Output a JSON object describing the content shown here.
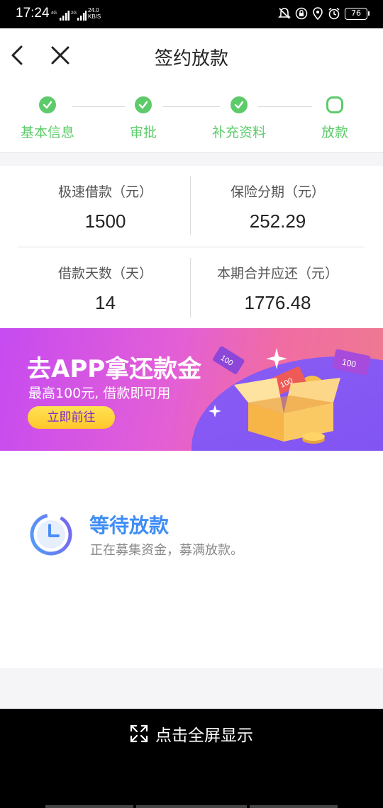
{
  "status_bar": {
    "time": "17:24",
    "net1": "4G",
    "net2": "2G",
    "speed_value": "24.0",
    "speed_unit": "KB/S",
    "battery": "76"
  },
  "header": {
    "title": "签约放款",
    "back_icon": "chevron-left-icon",
    "close_icon": "close-icon"
  },
  "steps": [
    {
      "label": "基本信息",
      "state": "done"
    },
    {
      "label": "审批",
      "state": "done"
    },
    {
      "label": "补充资料",
      "state": "done"
    },
    {
      "label": "放款",
      "state": "current"
    }
  ],
  "loan": {
    "amount_label": "极速借款（元）",
    "amount_value": "1500",
    "insurance_label": "保险分期（元）",
    "insurance_value": "252.29",
    "days_label": "借款天数（天）",
    "days_value": "14",
    "total_label": "本期合并应还（元）",
    "total_value": "1776.48"
  },
  "banner": {
    "title": "去APP拿还款金",
    "subtitle": "最高100元, 借款即可用",
    "cta": "立即前往",
    "ticket1": "100",
    "ticket2": "100",
    "ticket3": "100"
  },
  "status": {
    "title": "等待放款",
    "description": "正在募集资金，募满放款。",
    "icon": "clock-icon"
  },
  "fullscreen": {
    "label": "点击全屏显示",
    "icon": "expand-icon"
  },
  "colors": {
    "accent_green": "#5dcb6a",
    "accent_blue": "#3f8df5",
    "banner_purple": "#c64bf0",
    "cta_yellow": "#ffd43b"
  }
}
